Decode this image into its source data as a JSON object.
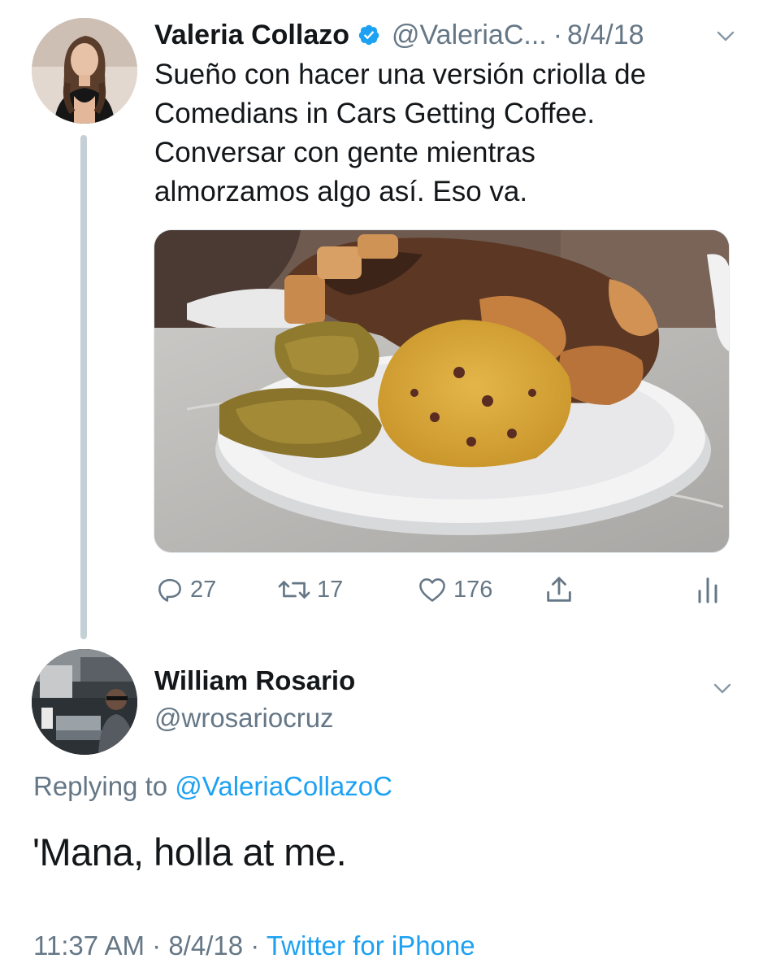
{
  "tweet": {
    "display_name": "Valeria Collazo",
    "handle": "@ValeriaC...",
    "separator": "·",
    "date": "8/4/18",
    "verified_icon": "verified-badge-icon",
    "text_lines": [
      "Sueño con hacer una versión criolla de",
      "Comedians in Cars Getting Coffee.",
      "Conversar con gente mientras",
      "almorzamos algo así. Eso va."
    ],
    "actions": {
      "replies": "27",
      "retweets": "17",
      "likes": "176"
    }
  },
  "reply": {
    "display_name": "William Rosario",
    "handle": "@wrosariocruz",
    "replying_prefix": "Replying to",
    "replying_to": "@ValeriaCollazoC",
    "text": "'Mana, holla at me.",
    "time": "11:37 AM",
    "sep1": "·",
    "date": "8/4/18",
    "sep2": "·",
    "source": "Twitter for iPhone"
  },
  "colors": {
    "link": "#1da1f2",
    "secondary": "#657786",
    "primary": "#14171a",
    "thread_line": "#c4cfd6"
  }
}
